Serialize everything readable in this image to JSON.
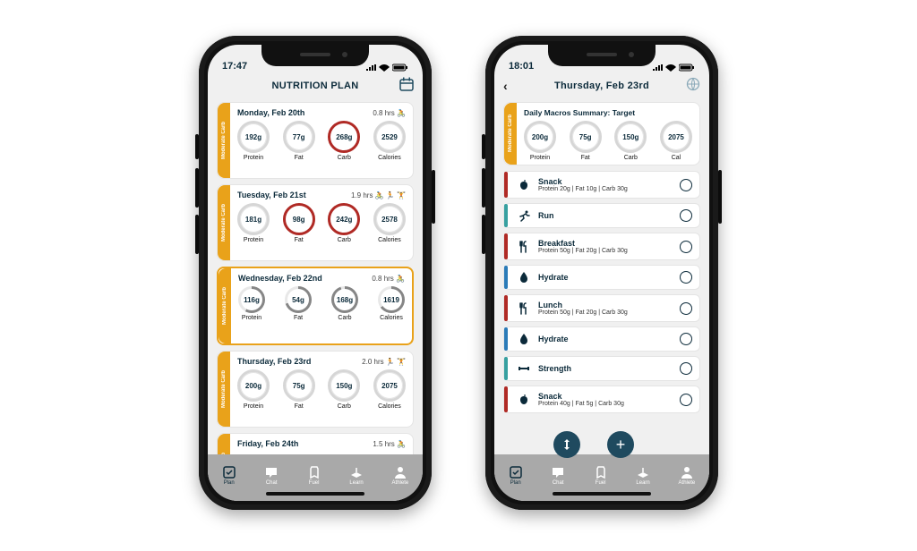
{
  "phone_left": {
    "status_time": "17:47",
    "title": "NUTRITION PLAN",
    "days": [
      {
        "name": "Monday, Feb 20th",
        "hours": "0.8 hrs",
        "activity": "🚴",
        "tab": "Moderate Carb",
        "active": false,
        "macros": [
          {
            "value": "192g",
            "label": "Protein",
            "style": "normal"
          },
          {
            "value": "77g",
            "label": "Fat",
            "style": "normal"
          },
          {
            "value": "268g",
            "label": "Carb",
            "style": "over"
          },
          {
            "value": "2529",
            "label": "Calories",
            "style": "normal"
          }
        ]
      },
      {
        "name": "Tuesday, Feb 21st",
        "hours": "1.9 hrs",
        "activity": "🚴 🏃 🏋️",
        "tab": "Moderate Carb",
        "active": false,
        "macros": [
          {
            "value": "181g",
            "label": "Protein",
            "style": "normal"
          },
          {
            "value": "98g",
            "label": "Fat",
            "style": "over"
          },
          {
            "value": "242g",
            "label": "Carb",
            "style": "over"
          },
          {
            "value": "2578",
            "label": "Calories",
            "style": "normal"
          }
        ]
      },
      {
        "name": "Wednesday, Feb 22nd",
        "hours": "0.8 hrs",
        "activity": "🚴",
        "tab": "Moderate Carb",
        "active": true,
        "macros": [
          {
            "value": "116g",
            "label": "Protein",
            "style": "partial",
            "p": 58
          },
          {
            "value": "54g",
            "label": "Fat",
            "style": "partial",
            "p": 70
          },
          {
            "value": "168g",
            "label": "Carb",
            "style": "partial",
            "p": 95
          },
          {
            "value": "1619",
            "label": "Calories",
            "style": "partial",
            "p": 65
          }
        ]
      },
      {
        "name": "Thursday, Feb 23rd",
        "hours": "2.0 hrs",
        "activity": "🏃 🏋️",
        "tab": "Moderate Carb",
        "active": false,
        "macros": [
          {
            "value": "200g",
            "label": "Protein",
            "style": "normal"
          },
          {
            "value": "75g",
            "label": "Fat",
            "style": "normal"
          },
          {
            "value": "150g",
            "label": "Carb",
            "style": "normal"
          },
          {
            "value": "2075",
            "label": "Calories",
            "style": "normal"
          }
        ]
      },
      {
        "name": "Friday, Feb 24th",
        "hours": "1.5 hrs",
        "activity": "🚴",
        "tab": "Moderate Carb",
        "active": false,
        "macros": []
      }
    ],
    "tabs": [
      "Plan",
      "Chat",
      "Fuel",
      "Learn",
      "Athlete"
    ]
  },
  "phone_right": {
    "status_time": "18:01",
    "title": "Thursday, Feb 23rd",
    "summary_label": "Daily Macros Summary: Target",
    "summary_tab": "Moderate Carb",
    "summary": [
      {
        "value": "200g",
        "label": "Protein"
      },
      {
        "value": "75g",
        "label": "Fat"
      },
      {
        "value": "150g",
        "label": "Carb"
      },
      {
        "value": "2075",
        "label": "Cal"
      }
    ],
    "items": [
      {
        "accent": "red",
        "icon": "apple",
        "title": "Snack",
        "sub": "Protein 20g | Fat 10g | Carb 30g"
      },
      {
        "accent": "teal",
        "icon": "run",
        "title": "Run",
        "sub": ""
      },
      {
        "accent": "red",
        "icon": "cutlery",
        "title": "Breakfast",
        "sub": "Protein 50g | Fat 20g | Carb 30g"
      },
      {
        "accent": "blue",
        "icon": "drop",
        "title": "Hydrate",
        "sub": ""
      },
      {
        "accent": "red",
        "icon": "cutlery",
        "title": "Lunch",
        "sub": "Protein 50g | Fat 20g | Carb 30g"
      },
      {
        "accent": "blue",
        "icon": "drop",
        "title": "Hydrate",
        "sub": ""
      },
      {
        "accent": "teal",
        "icon": "dumbbell",
        "title": "Strength",
        "sub": ""
      },
      {
        "accent": "red",
        "icon": "apple",
        "title": "Snack",
        "sub": "Protein 40g | Fat 5g | Carb 30g"
      }
    ],
    "tabs": [
      "Plan",
      "Chat",
      "Fuel",
      "Learn",
      "Athlete"
    ]
  },
  "icons": {
    "apple": "🍎",
    "run": "🏃",
    "cutlery": "🍴",
    "drop": "💧",
    "dumbbell": "🏋️"
  }
}
